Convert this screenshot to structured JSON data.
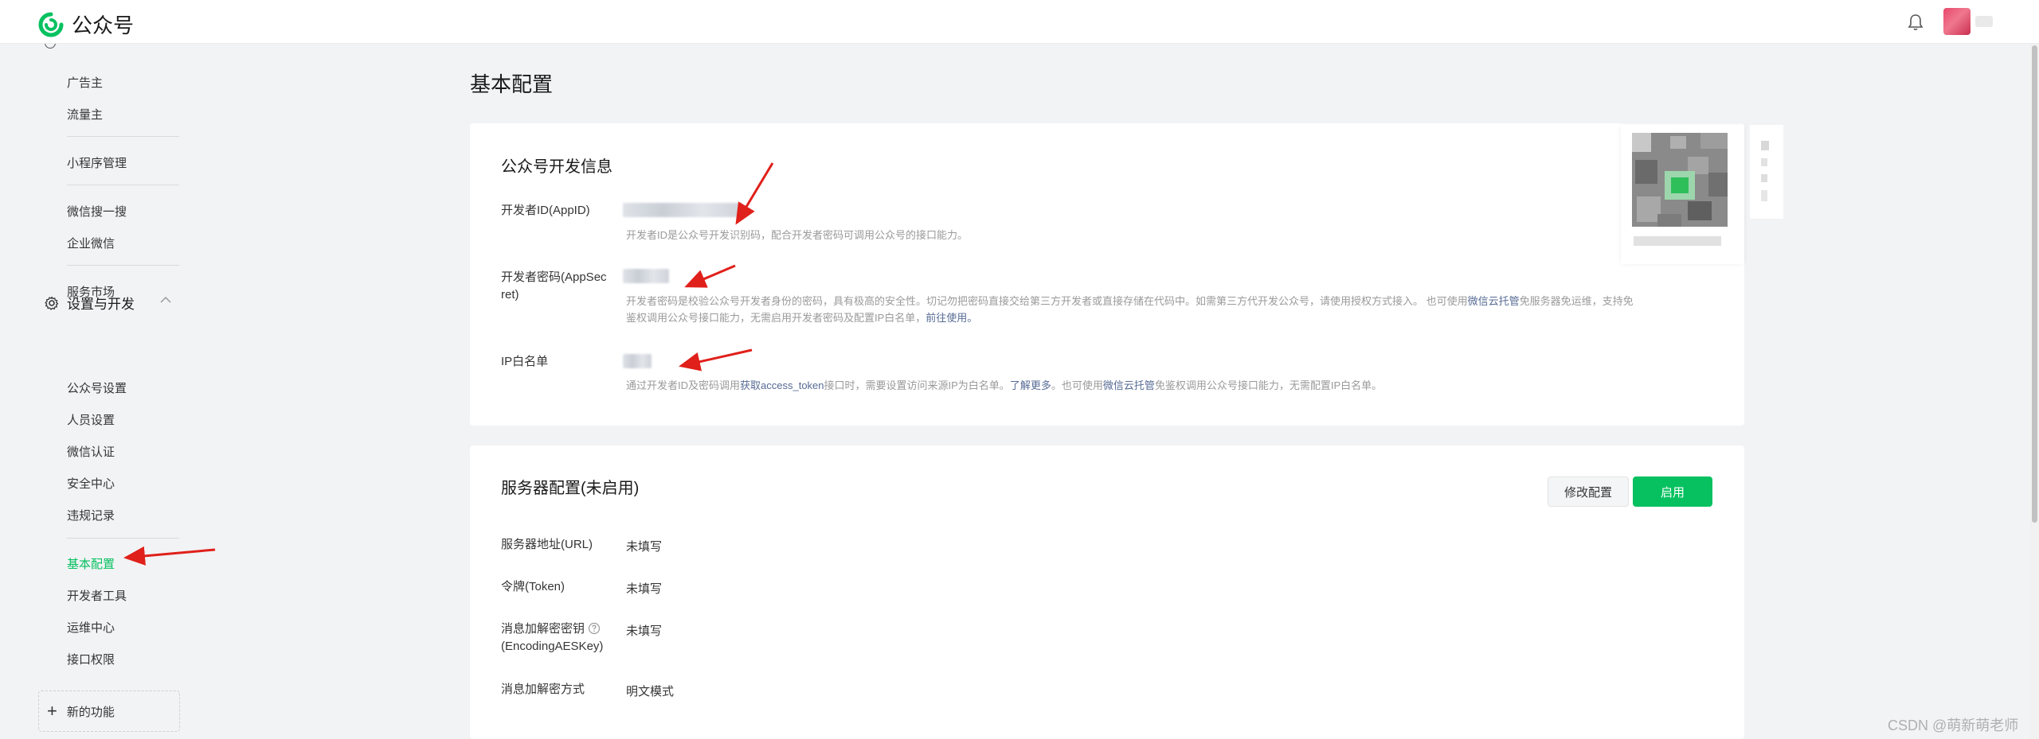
{
  "app": {
    "title": "公众号"
  },
  "sidebar": {
    "items": [
      {
        "label": "广告主"
      },
      {
        "label": "流量主"
      },
      {
        "label": "小程序管理"
      },
      {
        "label": "微信搜一搜"
      },
      {
        "label": "企业微信"
      },
      {
        "label": "服务市场"
      }
    ],
    "group": {
      "label": "设置与开发"
    },
    "sub_items": [
      {
        "label": "公众号设置"
      },
      {
        "label": "人员设置"
      },
      {
        "label": "微信认证"
      },
      {
        "label": "安全中心"
      },
      {
        "label": "违规记录"
      },
      {
        "label": "基本配置"
      },
      {
        "label": "开发者工具"
      },
      {
        "label": "运维中心"
      },
      {
        "label": "接口权限"
      }
    ],
    "new_function": "新的功能"
  },
  "page": {
    "title": "基本配置"
  },
  "dev_info": {
    "title": "公众号开发信息",
    "appid_label": "开发者ID(AppID)",
    "appid_desc": "开发者ID是公众号开发识别码，配合开发者密码可调用公众号的接口能力。",
    "secret_label_1": "开发者密码(AppSec",
    "secret_label_2": "ret)",
    "secret_desc_1a": "开发者密码是校验公众号开发者身份的密码，具有极高的安全性。切记勿把密码直接交给第三方开发者或直接存储在代码中。如需第三方代开发公众号，请使用授权方式接入。 也可使用",
    "secret_desc_link1": "微信云托管",
    "secret_desc_1b": "免服务器免运维，支持免",
    "secret_desc_2a": "鉴权调用公众号接口能力，无需启用开发者密码及配置IP白名单，",
    "secret_desc_link2": "前往使用。",
    "ip_label": "IP白名单",
    "ip_desc_a": "通过开发者ID及密码调用",
    "ip_desc_link1": "获取access_token",
    "ip_desc_b": "接口时，需要设置访问来源IP为白名单。",
    "ip_desc_link2": "了解更多",
    "ip_desc_c": "。也可使用",
    "ip_desc_link3": "微信云托管",
    "ip_desc_d": "免鉴权调用公众号接口能力，无需配置IP白名单。"
  },
  "server_config": {
    "title": "服务器配置(未启用)",
    "modify_button": "修改配置",
    "enable_button": "启用",
    "rows": [
      {
        "label": "服务器地址(URL)",
        "value": "未填写"
      },
      {
        "label": "令牌(Token)",
        "value": "未填写"
      },
      {
        "label": "消息加解密密钥",
        "label2": "(EncodingAESKey)",
        "value": "未填写"
      },
      {
        "label": "消息加解密方式",
        "value": "明文模式"
      }
    ]
  },
  "watermark": "CSDN @萌新萌老师",
  "colors": {
    "accent": "#07c160",
    "link": "#576b95",
    "arrow": "#e0201a"
  }
}
